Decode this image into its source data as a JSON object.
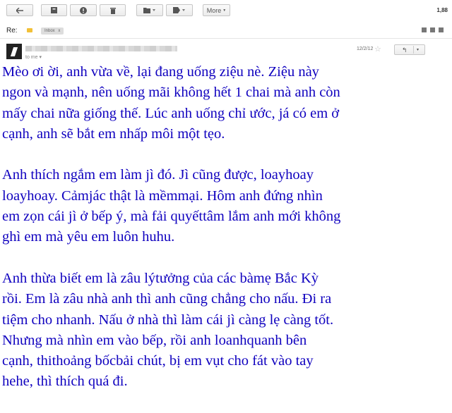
{
  "toolbar": {
    "more_label": "More",
    "message_count": "1,88",
    "icons": [
      "back-arrow-icon",
      "archive-icon",
      "spam-icon",
      "delete-icon",
      "folder-icon",
      "label-icon"
    ]
  },
  "subject": {
    "prefix": "Re:",
    "label": "Inbox",
    "label_close": "x"
  },
  "sender": {
    "to_line": "to me",
    "date": "12/2/12",
    "star": "☆",
    "reply_icon": "↰",
    "menu_icon": "▾"
  },
  "message": {
    "paragraphs": [
      [
        "Mèo ơi ời, anh vừa về, lại đang uống ziệu nè. Ziệu này",
        "ngon và mạnh, nên uống mãi không hết 1 chai mà anh còn",
        "mấy chai nữa giống thế. Lúc anh uống chỉ ước, já có em ở",
        "cạnh, anh sẽ bắt em nhấp môi một tẹo."
      ],
      [
        "Anh thích ngắm em làm jì đó. Jì cũng được, loayhoay",
        "loayhoay. Cảmjác thật là mềmmại. Hôm anh đứng nhìn",
        "em zọn cái jì ở bếp ý, mà fải quyếttâm lắm anh mới không",
        "ghì em mà yêu em luôn huhu."
      ],
      [
        "Anh thừa biết em là zâu lýtưởng của các bàmẹ Bắc Kỳ",
        "rồi. Em là zâu nhà anh thì anh cũng chẳng cho nấu. Đi ra",
        "tiệm cho nhanh. Nấu ở nhà thì làm cái jì càng lẹ càng tốt.",
        "Nhưng mà nhìn em vào bếp, rồi anh loanhquanh bên",
        "cạnh, thithoảng bốcbải chút, bị em vụt cho fát vào tay",
        "hehe, thì thích quá đi."
      ]
    ]
  },
  "colors": {
    "message_text": "#0f00bf",
    "label_yellow": "#f2c037"
  }
}
